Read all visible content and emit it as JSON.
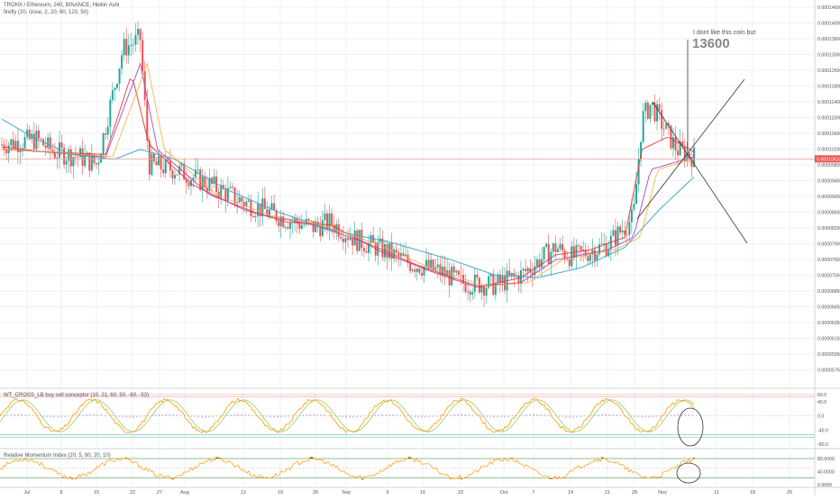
{
  "header": {
    "symbol_line": "TRONX / Ethereum, 240, BINANCE, Heikin Ashi",
    "indicator_line": "firefly (20, close, 2, 20, 60, 120, 50)"
  },
  "annotation": {
    "text": "I dont like this coin but",
    "value": "13600"
  },
  "colors": {
    "up": "#26a69a",
    "down": "#ef5350",
    "ma_fast": "#e53935",
    "ma_mid": "#ab47bc",
    "ma_orange": "#ffa726",
    "ma_slow": "#3fa7c9",
    "last_price_line": "#ef9a9a",
    "last_price_tag": "#ef5350",
    "grid": "#eef0f3",
    "axis_text": "#555555",
    "trend_line": "#333333",
    "wt_line1": "#ff9800",
    "wt_line2": "#9ccc65",
    "wt_hist": "#7e57c2",
    "rmi_line": "#ff9800",
    "rmi_fill_up": "#2e7d32",
    "rmi_fill_down": "#e53935"
  },
  "chart_data": [
    {
      "type": "candlestick",
      "title": "TRONX / Ethereum, 240, BINANCE, Heikin Ashi",
      "x_ticks": [
        "Jul",
        "8",
        "15",
        "22",
        "27",
        "Aug",
        "12",
        "19",
        "26",
        "Sep",
        "9",
        "16",
        "23",
        "Oct",
        "7",
        "14",
        "21",
        "28",
        "Nov",
        "11",
        "18",
        "25"
      ],
      "y_ticks": [
        "0.00014600",
        "0.00014000",
        "0.00013600",
        "0.00013000",
        "0.00012600",
        "0.00011800",
        "0.00011400",
        "0.00011000",
        "0.00010600",
        "0.00010200",
        "0.00009800",
        "0.00009400",
        "0.00009000",
        "0.00008600",
        "0.00008200",
        "0.00007900",
        "0.00007600",
        "0.00007050",
        "0.00006850",
        "0.00006650",
        "0.00006350",
        "0.00006150",
        "0.00005950",
        "0.00005750"
      ],
      "last_price": "0.00010610",
      "close_path": [
        [
          0,
          0.000109
        ],
        [
          4,
          0.00011
        ],
        [
          6,
          0.0001075
        ],
        [
          9,
          0.0001065
        ],
        [
          11,
          0.000105
        ],
        [
          14,
          0.000128
        ],
        [
          16,
          0.00013
        ],
        [
          17,
          0.000105
        ],
        [
          20,
          0.000104
        ],
        [
          24,
          0.000101
        ],
        [
          28,
          9.75e-05
        ],
        [
          33,
          9.4e-05
        ],
        [
          36,
          9.25e-05
        ],
        [
          38,
          9.35e-05
        ],
        [
          41,
          9e-05
        ],
        [
          44,
          8.8e-05
        ],
        [
          47,
          8.55e-05
        ],
        [
          51,
          8.35e-05
        ],
        [
          53,
          8.15e-05
        ],
        [
          57,
          8.1e-05
        ],
        [
          60,
          8.3e-05
        ],
        [
          64,
          8.85e-05
        ],
        [
          66,
          8.65e-05
        ],
        [
          70,
          8.9e-05
        ],
        [
          73,
          9.45e-05
        ],
        [
          74,
          0.000114
        ],
        [
          75,
          0.000117
        ],
        [
          78,
          0.000108
        ],
        [
          80,
          0.0001065
        ]
      ],
      "moving_averages": [
        {
          "name": "fast",
          "values": [
            [
              0,
              0.0001085
            ],
            [
              5,
              0.0001075
            ],
            [
              12,
              0.000107
            ],
            [
              15,
              0.000123
            ],
            [
              17,
              0.000109
            ],
            [
              22,
              0.000101
            ],
            [
              28,
              9.6e-05
            ],
            [
              33,
              9.35e-05
            ],
            [
              38,
              9.3e-05
            ],
            [
              44,
              8.75e-05
            ],
            [
              50,
              8.35e-05
            ],
            [
              55,
              8.05e-05
            ],
            [
              60,
              8.25e-05
            ],
            [
              64,
              8.7e-05
            ],
            [
              68,
              8.8e-05
            ],
            [
              72,
              9.05e-05
            ],
            [
              74,
              0.000108
            ],
            [
              77,
              0.0001105
            ],
            [
              80,
              0.0001075
            ]
          ]
        },
        {
          "name": "mid",
          "values": [
            [
              0,
              0.000108
            ],
            [
              5,
              0.0001075
            ],
            [
              12,
              0.0001065
            ],
            [
              16,
              0.000125
            ],
            [
              18,
              0.000108
            ],
            [
              24,
              9.9e-05
            ],
            [
              30,
              9.5e-05
            ],
            [
              36,
              9.3e-05
            ],
            [
              42,
              8.95e-05
            ],
            [
              48,
              8.5e-05
            ],
            [
              55,
              8.08e-05
            ],
            [
              60,
              8.15e-05
            ],
            [
              64,
              8.6e-05
            ],
            [
              70,
              8.8e-05
            ],
            [
              73,
              9.05e-05
            ],
            [
              75,
              0.000104
            ],
            [
              80,
              0.0001065
            ]
          ]
        },
        {
          "name": "slow",
          "values": [
            [
              0,
              0.000114
            ],
            [
              4,
              0.00011
            ],
            [
              8,
              0.000107
            ],
            [
              13,
              0.000106
            ],
            [
              16,
              0.000108
            ],
            [
              20,
              0.000106
            ],
            [
              26,
              0.0001
            ],
            [
              32,
              9.55e-05
            ],
            [
              38,
              9.2e-05
            ],
            [
              45,
              8.95e-05
            ],
            [
              52,
              8.6e-05
            ],
            [
              57,
              8.3e-05
            ],
            [
              62,
              8.25e-05
            ],
            [
              67,
              8.45e-05
            ],
            [
              72,
              8.85e-05
            ],
            [
              76,
              9.6e-05
            ],
            [
              80,
              0.0001025
            ]
          ]
        }
      ]
    },
    {
      "type": "line",
      "title": "WT_CROSS_LB buy sell conceptor (10, 21, 60, 50, -60, -53)",
      "y_ticks": [
        "60.0",
        "40.0",
        "0.0",
        "-40.0",
        "-80.0"
      ],
      "y_range": [
        -80,
        60
      ],
      "levels": [
        60,
        53,
        -53,
        -60
      ]
    },
    {
      "type": "area",
      "title": "Relative Momentum Index (20, 5, 80, 20, 10)",
      "y_ticks": [
        "80.0000",
        "40.0000",
        "0.0000"
      ],
      "y_range": [
        0,
        80
      ]
    }
  ]
}
